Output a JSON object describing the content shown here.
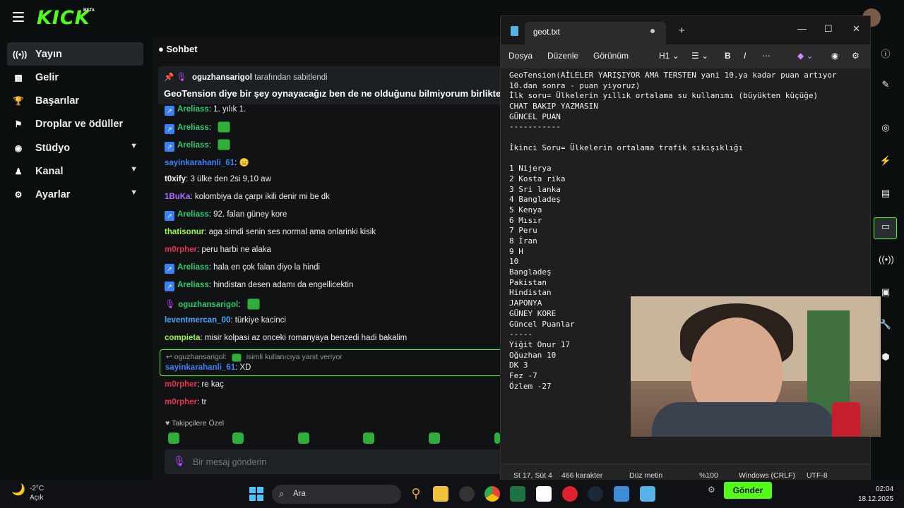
{
  "kick": {
    "logo": "KICK",
    "beta": "BETA",
    "nav": [
      {
        "label": "Yayın",
        "icon": "broadcast-icon",
        "active": true
      },
      {
        "label": "Gelir",
        "icon": "revenue-icon"
      },
      {
        "label": "Başarılar",
        "icon": "trophy-icon"
      },
      {
        "label": "Droplar ve ödüller",
        "icon": "drops-icon"
      },
      {
        "label": "Stüdyo",
        "icon": "studio-icon",
        "expandable": true
      },
      {
        "label": "Kanal",
        "icon": "channel-icon",
        "expandable": true
      },
      {
        "label": "Ayarlar",
        "icon": "gear-icon",
        "expandable": true
      }
    ]
  },
  "chat": {
    "title": "Sohbet",
    "pinned": {
      "user": "oguzhansarigol",
      "suffix": "tarafından sabitlendi",
      "text": "GeoTension diye bir şey oynayacağız ben de ne olduğunu bilmiyorum birlikte öğrenic"
    },
    "messages": [
      {
        "user": "Areliass",
        "text": "1. yılık 1.",
        "color": "#2ecc71",
        "badge": true
      },
      {
        "user": "Areliass",
        "text": "",
        "color": "#2ecc71",
        "badge": true,
        "emote": true
      },
      {
        "user": "Areliass",
        "text": "",
        "color": "#2ecc71",
        "badge": true,
        "emote": true
      },
      {
        "user": "sayinkarahanli_61",
        "text": "😑",
        "color": "#3b82f6"
      },
      {
        "user": "t0xify",
        "text": "3 ülke den 2si 9,10 aw",
        "color": "#eeeeee"
      },
      {
        "user": "1BuKa",
        "text": "kolombiya da çarpı ikili denir mi be dk",
        "color": "#b36bff"
      },
      {
        "user": "Areliass",
        "text": "92. falan güney kore",
        "color": "#2ecc71",
        "badge": true
      },
      {
        "user": "thatisonur",
        "text": "aga simdi senin ses normal ama onlarinki kisik",
        "color": "#9ef542"
      },
      {
        "user": "m0rpher",
        "text": "peru harbi ne alaka",
        "color": "#e5334b"
      },
      {
        "user": "Areliass",
        "text": "hala en çok falan diyo la hindi",
        "color": "#2ecc71",
        "badge": true
      },
      {
        "user": "Areliass",
        "text": "hindistan desen adamı da engellicektin",
        "color": "#2ecc71",
        "badge": true
      },
      {
        "user": "oguzhansarigol",
        "text": "",
        "color": "#2ecc71",
        "mic": true,
        "emote": true
      },
      {
        "user": "leventmercan_00",
        "text": "türkiye kacinci",
        "color": "#4aa8ff"
      },
      {
        "user": "compieta",
        "text": "misir kolpasi az onceki romanyaya benzedi hadi bakalim",
        "color": "#9ef542"
      }
    ],
    "reply": {
      "top_user": "oguzhansarigol:",
      "top_text": "isimli kullanıcıya yanıt veriyor",
      "user": "sayinkarahanli_61",
      "text": "XD"
    },
    "messages_after": [
      {
        "user": "m0rpher",
        "text": "re kaç",
        "color": "#e5334b"
      },
      {
        "user": "m0rpher",
        "text": "tr",
        "color": "#e5334b"
      }
    ],
    "followers_label": "Takipçilere Özel",
    "input_placeholder": "Bir mesaj gönderin",
    "send_label": "Gönder"
  },
  "notepad": {
    "tab_title": "geot.txt",
    "menu": [
      "Dosya",
      "Düzenle",
      "Görünüm"
    ],
    "heading_select": "H1",
    "lines": [
      "GeoTension(AİLELER YARIŞIYOR AMA TERSTEN yani 10.ya kadar puan artıyor",
      "10.dan sonra - puan yiyoruz)",
      "İlk soru= Ülkelerin yıllık ortalama su kullanımı (büyükten küçüğe)",
      "CHAT BAKIP YAZMASIN",
      "GÜNCEL PUAN",
      "-----------",
      "",
      "İkinci Soru= Ülkelerin ortalama trafik sıkışıklığı",
      "",
      "1 Nijerya",
      "2 Kosta rika",
      "3 Sri lanka",
      "4 Bangladeş",
      "5 Kenya",
      "6 Mısır",
      "7 Peru",
      "8 İran",
      "9 H",
      "10",
      "Bangladeş",
      "Pakistan",
      "Hindistan",
      "JAPONYA",
      "GÜNEY KORE",
      "Güncel Puanlar",
      "-----",
      "Yiğit Onur 17",
      "Oğuzhan 10",
      "DK 3",
      "Fez -7",
      "Özlem -27"
    ],
    "status": {
      "position": "St 17, Süt 4",
      "chars": "466 karakter",
      "mode": "Düz metin",
      "zoom": "%100",
      "eol": "Windows (CRLF)",
      "encoding": "UTF-8"
    }
  },
  "taskbar": {
    "temp": "-2°C",
    "weather": "Açık",
    "search_label": "Ara",
    "time": "02:04",
    "date": "18.12.2025"
  }
}
